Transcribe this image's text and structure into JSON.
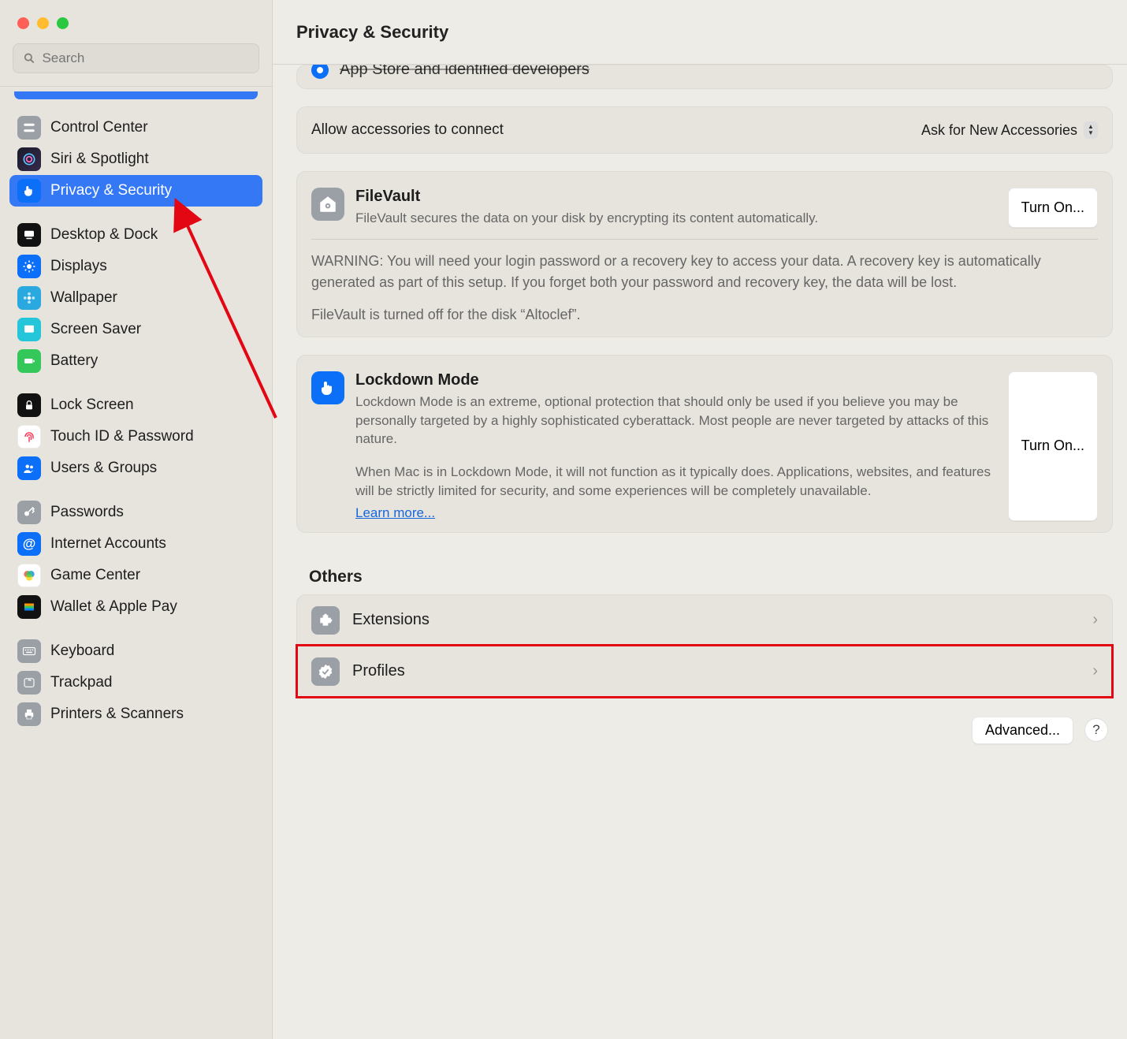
{
  "header": {
    "title": "Privacy & Security"
  },
  "search": {
    "placeholder": "Search"
  },
  "sidebar": {
    "groups": [
      {
        "items": [
          {
            "label": "Control Center"
          },
          {
            "label": "Siri & Spotlight"
          },
          {
            "label": "Privacy & Security"
          }
        ]
      },
      {
        "items": [
          {
            "label": "Desktop & Dock"
          },
          {
            "label": "Displays"
          },
          {
            "label": "Wallpaper"
          },
          {
            "label": "Screen Saver"
          },
          {
            "label": "Battery"
          }
        ]
      },
      {
        "items": [
          {
            "label": "Lock Screen"
          },
          {
            "label": "Touch ID & Password"
          },
          {
            "label": "Users & Groups"
          }
        ]
      },
      {
        "items": [
          {
            "label": "Passwords"
          },
          {
            "label": "Internet Accounts"
          },
          {
            "label": "Game Center"
          },
          {
            "label": "Wallet & Apple Pay"
          }
        ]
      },
      {
        "items": [
          {
            "label": "Keyboard"
          },
          {
            "label": "Trackpad"
          },
          {
            "label": "Printers & Scanners"
          }
        ]
      }
    ]
  },
  "peek_row": {
    "label": "App Store and identified developers"
  },
  "accessories": {
    "label": "Allow accessories to connect",
    "value": "Ask for New Accessories"
  },
  "filevault": {
    "title": "FileVault",
    "desc": "FileVault secures the data on your disk by encrypting its content automatically.",
    "warning": "WARNING: You will need your login password or a recovery key to access your data. A recovery key is automatically generated as part of this setup. If you forget both your password and recovery key, the data will be lost.",
    "status": "FileVault is turned off for the disk “Altoclef”.",
    "button": "Turn On..."
  },
  "lockdown": {
    "title": "Lockdown Mode",
    "desc1": "Lockdown Mode is an extreme, optional protection that should only be used if you believe you may be personally targeted by a highly sophisticated cyberattack. Most people are never targeted by attacks of this nature.",
    "desc2": "When Mac is in Lockdown Mode, it will not function as it typically does. Applications, websites, and features will be strictly limited for security, and some experiences will be completely unavailable.",
    "learn_more": "Learn more...",
    "button": "Turn On..."
  },
  "others": {
    "heading": "Others",
    "extensions": "Extensions",
    "profiles": "Profiles"
  },
  "footer": {
    "advanced": "Advanced...",
    "help": "?"
  },
  "colors": {
    "accent": "#3478f6"
  }
}
